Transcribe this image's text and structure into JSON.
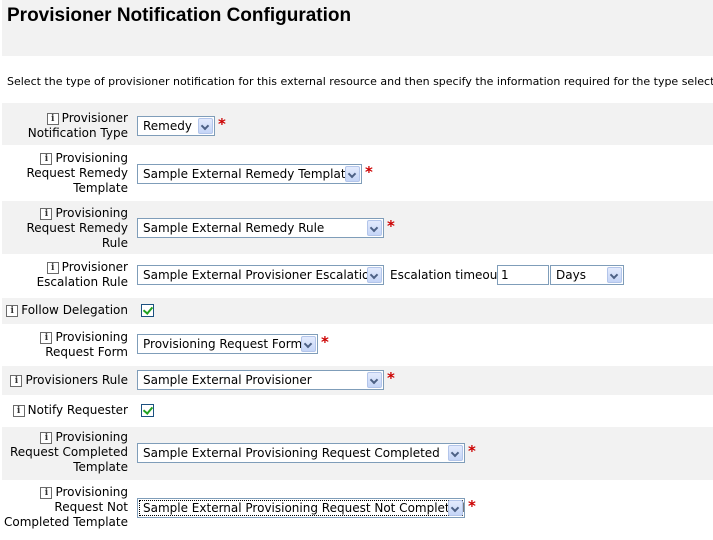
{
  "page": {
    "title": "Provisioner Notification Configuration",
    "intro": "Select the type of provisioner notification for this external resource and then specify the information required for the type selected."
  },
  "info_glyph": "i",
  "required_mark": "*",
  "fields": {
    "notification_type": {
      "label": "Provisioner Notification Type",
      "value": "Remedy"
    },
    "remedy_template": {
      "label": "Provisioning Request Remedy Template",
      "value": "Sample External Remedy Template"
    },
    "remedy_rule": {
      "label": "Provisioning Request Remedy Rule",
      "value": "Sample External Remedy Rule"
    },
    "escalation_rule": {
      "label": "Provisioner Escalation Rule",
      "value": "Sample External Provisioner Escalation",
      "timeout_label": "Escalation timeout",
      "timeout_value": "1",
      "timeout_unit": "Days"
    },
    "follow_delegation": {
      "label": "Follow Delegation",
      "checked": true
    },
    "request_form": {
      "label": "Provisioning Request Form",
      "value": "Provisioning Request Form"
    },
    "provisioners_rule": {
      "label": "Provisioners Rule",
      "value": "Sample External Provisioner"
    },
    "notify_requester": {
      "label": "Notify Requester",
      "checked": true
    },
    "completed_template": {
      "label": "Provisioning Request Completed Template",
      "value": "Sample External Provisioning Request Completed"
    },
    "not_completed_template": {
      "label": "Provisioning Request Not Completed Template",
      "value": "Sample External Provisioning Request Not Completed"
    }
  }
}
